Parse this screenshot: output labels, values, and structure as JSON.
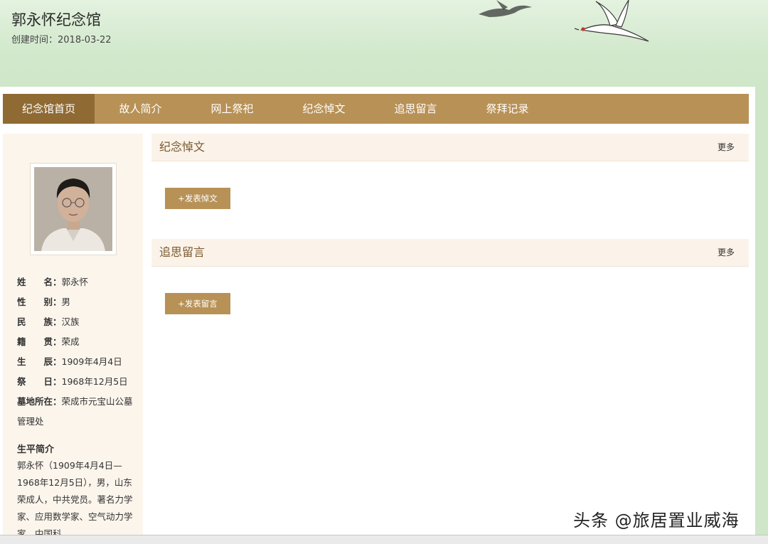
{
  "header": {
    "title": "郭永怀纪念馆",
    "created": "创建时间：2018-03-22"
  },
  "nav": {
    "tabs": [
      {
        "label": "纪念馆首页",
        "active": true
      },
      {
        "label": "故人简介"
      },
      {
        "label": "网上祭祀"
      },
      {
        "label": "纪念悼文"
      },
      {
        "label": "追思留言"
      },
      {
        "label": "祭拜记录"
      }
    ]
  },
  "profile": {
    "rows": [
      {
        "label": "姓　　名：",
        "value": "郭永怀"
      },
      {
        "label": "性　　别：",
        "value": "男"
      },
      {
        "label": "民　　族：",
        "value": "汉族"
      },
      {
        "label": "籍　　贯：",
        "value": "荣成"
      },
      {
        "label": "生　　辰：",
        "value": "1909年4月4日"
      },
      {
        "label": "祭　　日：",
        "value": "1968年12月5日"
      }
    ],
    "grave_label": "墓地所在：",
    "grave_value": "荣成市元宝山公墓",
    "grave_value_2": "管理处",
    "bio_title": "生平简介",
    "bio_text": "郭永怀（1909年4月4日—1968年12月5日），男，山东荣成人，中共党员。著名力学家、应用数学家、空气动力学家，中国科"
  },
  "sections": {
    "eulogy": {
      "title": "纪念悼文",
      "more": "更多",
      "button": "+发表悼文"
    },
    "messages": {
      "title": "追思留言",
      "more": "更多",
      "button": "+发表留言"
    }
  },
  "watermark": "头条 @旅居置业威海",
  "colors": {
    "nav": "#b89156",
    "nav_active": "#8f6a33",
    "sidebar": "#fbf5ec",
    "banner": "#d9ead3"
  }
}
